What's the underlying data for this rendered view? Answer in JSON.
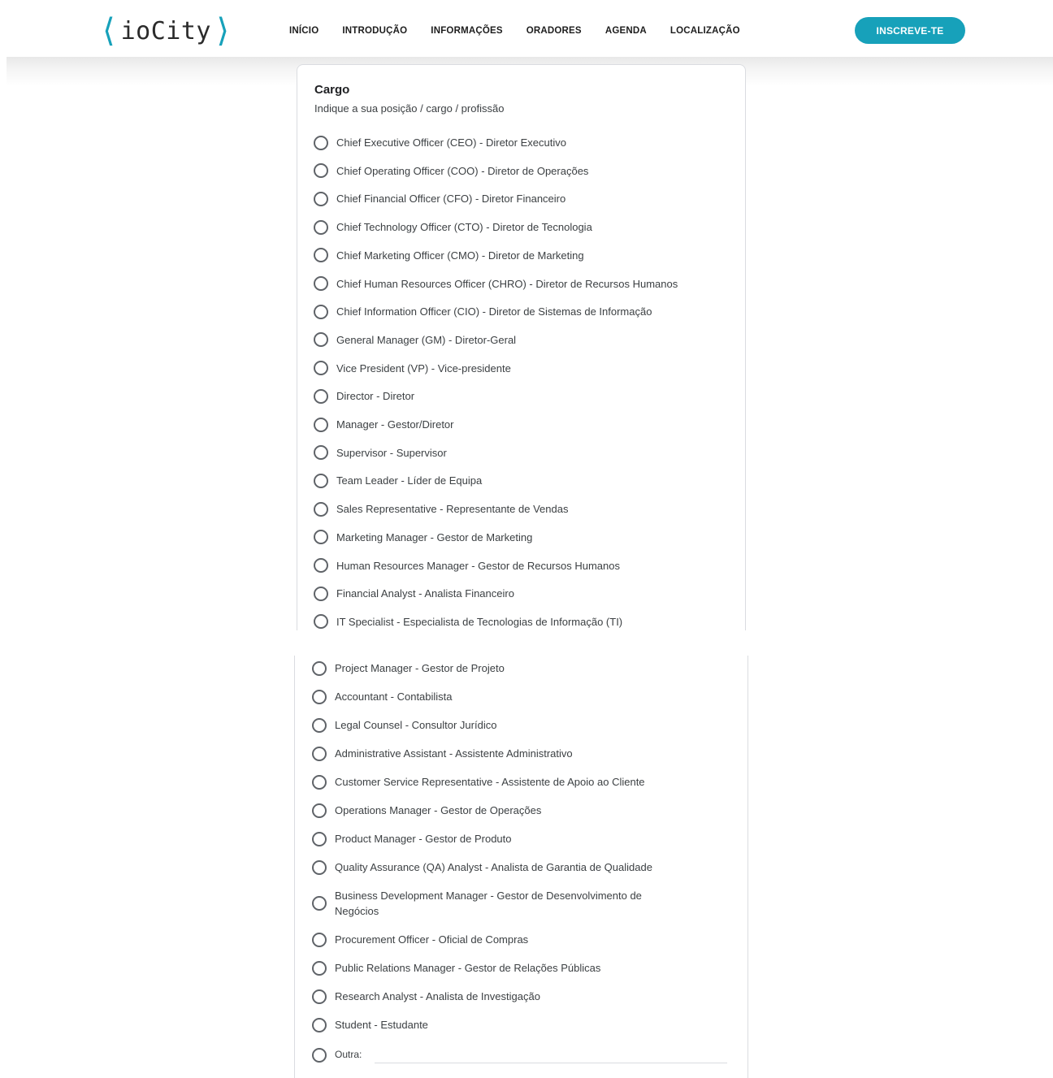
{
  "header": {
    "logo_open": "⟨",
    "logo_text": "ioCity",
    "logo_close": "⟩",
    "nav": [
      "INÍCIO",
      "INTRODUÇÃO",
      "INFORMAÇÕES",
      "ORADORES",
      "AGENDA",
      "LOCALIZAÇÃO"
    ],
    "cta_label": "INSCREVE-TE"
  },
  "colors": {
    "accent": "#17a1ba",
    "radio_border": "#5f6368",
    "card_border": "#dadce0"
  },
  "question": {
    "title": "Cargo",
    "description": "Indique a sua posição / cargo / profissão",
    "options_top": [
      "Chief Executive Officer (CEO) - Diretor Executivo",
      "Chief Operating Officer (COO) - Diretor de Operações",
      "Chief Financial Officer (CFO) - Diretor Financeiro",
      "Chief Technology Officer (CTO) - Diretor de Tecnologia",
      "Chief Marketing Officer (CMO) - Diretor de Marketing",
      "Chief Human Resources Officer (CHRO) - Diretor de Recursos Humanos",
      "Chief Information Officer (CIO) - Diretor de Sistemas de Informação",
      "General Manager (GM) - Diretor-Geral",
      "Vice President (VP) - Vice-presidente",
      "Director - Diretor",
      "Manager - Gestor/Diretor",
      "Supervisor - Supervisor",
      "Team Leader - Líder de Equipa",
      "Sales Representative - Representante de Vendas",
      "Marketing Manager - Gestor de Marketing",
      "Human Resources Manager - Gestor de Recursos Humanos",
      "Financial Analyst - Analista Financeiro",
      "IT Specialist - Especialista de Tecnologias de Informação (TI)"
    ],
    "options_bottom": [
      "Project Manager - Gestor de Projeto",
      "Accountant - Contabilista",
      "Legal Counsel - Consultor Jurídico",
      "Administrative Assistant - Assistente Administrativo",
      "Customer Service Representative - Assistente de Apoio ao Cliente",
      "Operations Manager - Gestor de Operações",
      "Product Manager - Gestor de Produto",
      "Quality Assurance (QA) Analyst - Analista de Garantia de Qualidade",
      "Business Development Manager - Gestor de Desenvolvimento de Negócios",
      "Procurement Officer - Oficial de Compras",
      "Public Relations Manager - Gestor de Relações Públicas",
      "Research Analyst - Analista de Investigação",
      "Student - Estudante"
    ],
    "other_label": "Outra:",
    "other_value": ""
  }
}
